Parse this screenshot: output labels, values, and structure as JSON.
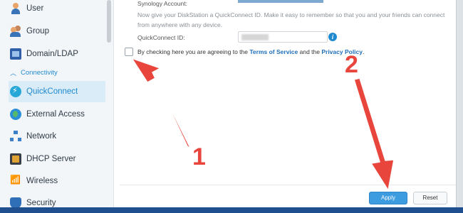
{
  "sidebar": {
    "items": [
      {
        "label": "User",
        "icon": "user-icon"
      },
      {
        "label": "Group",
        "icon": "group-icon"
      },
      {
        "label": "Domain/LDAP",
        "icon": "domain-icon"
      },
      {
        "label": "QuickConnect",
        "icon": "quickconnect-icon",
        "active": true
      },
      {
        "label": "External Access",
        "icon": "globe-icon"
      },
      {
        "label": "Network",
        "icon": "network-icon"
      },
      {
        "label": "DHCP Server",
        "icon": "dhcp-icon"
      },
      {
        "label": "Wireless",
        "icon": "wireless-icon"
      },
      {
        "label": "Security",
        "icon": "shield-icon"
      }
    ],
    "section_label": "Connectivity"
  },
  "main": {
    "account_label": "Synology Account:",
    "description": "Now give your DiskStation a QuickConnect ID. Make it easy to remember so that you and your friends can connect from anywhere with any device.",
    "quickconnect_label": "QuickConnect ID:",
    "agree_prefix": "By checking here you are agreeing to the ",
    "terms_link": "Terms of Service",
    "agree_middle": " and the ",
    "privacy_link": "Privacy Policy",
    "agree_suffix": "."
  },
  "footer": {
    "apply_label": "Apply",
    "reset_label": "Reset"
  },
  "annotations": {
    "step1": "1",
    "step2": "2"
  },
  "colors": {
    "accent": "#1f8ad0",
    "arrow": "#e8453c",
    "apply_button": "#3d9be0"
  }
}
